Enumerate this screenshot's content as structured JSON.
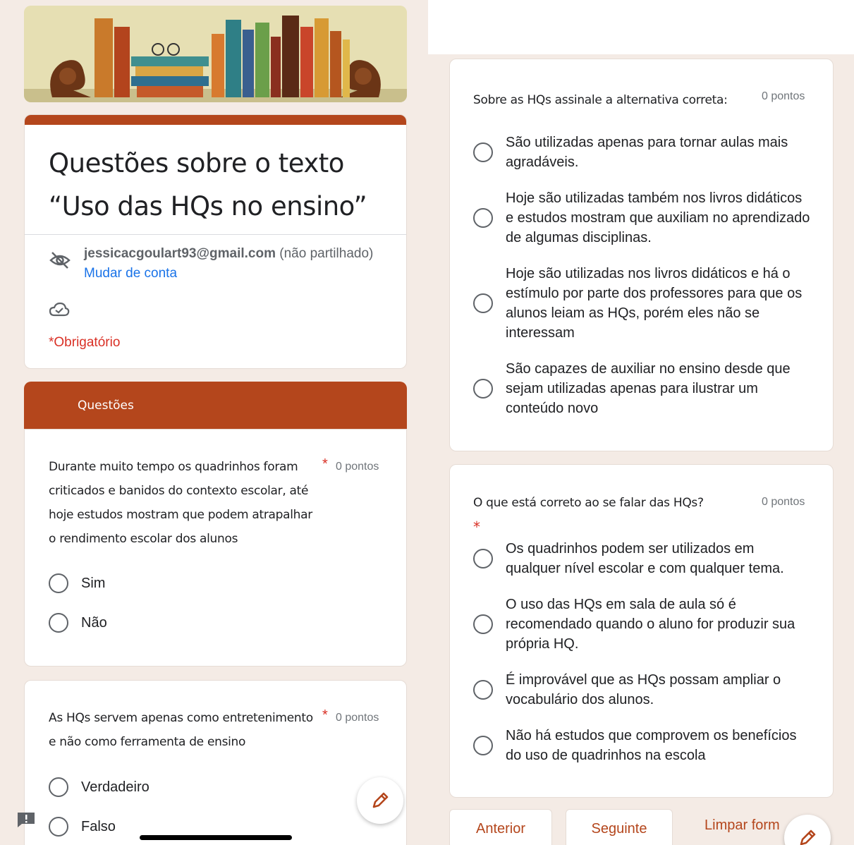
{
  "form": {
    "title": "Questões sobre o texto “Uso das HQs no ensino”",
    "account_email": "jessicacgoulart93@gmail.com",
    "account_note": "(não partilhado)",
    "switch_account": "Mudar de conta",
    "required_note": "*Obrigatório"
  },
  "section": {
    "title": "Questões"
  },
  "left_questions": [
    {
      "text": "Durante muito tempo os quadrinhos foram criticados e banidos do contexto escolar, até hoje estudos mostram que podem atrapalhar o rendimento escolar dos alunos",
      "required_mark": "*",
      "points": "0 pontos",
      "options": [
        "Sim",
        "Não"
      ]
    },
    {
      "text": "As HQs servem apenas como entretenimento e não como ferramenta de ensino",
      "required_mark": "*",
      "points": "0 pontos",
      "options": [
        "Verdadeiro",
        "Falso"
      ]
    }
  ],
  "right_questions": [
    {
      "text": "Sobre as HQs assinale a alternativa correta:",
      "points": "0 pontos",
      "options": [
        "São utilizadas apenas para tornar aulas mais agradáveis.",
        "Hoje são utilizadas também nos livros didáticos e estudos mostram que auxiliam no aprendizado de algumas disciplinas.",
        "Hoje são utilizadas nos livros didáticos e há o estímulo por parte dos professores para que os alunos leiam as HQs, porém eles não se interessam",
        "São capazes de auxiliar no ensino desde que sejam utilizadas apenas para ilustrar um conteúdo novo"
      ]
    },
    {
      "text": "O que está correto ao se falar das HQs?",
      "required_mark": "*",
      "points": "0 pontos",
      "options": [
        "Os quadrinhos podem ser utilizados em qualquer nível escolar e com qualquer tema.",
        "O uso das HQs em sala de aula só é recomendado quando o aluno for produzir sua própria HQ.",
        "É improvável que as HQs possam ampliar o vocabulário dos alunos.",
        "Não há estudos que comprovem os benefícios do uso de quadrinhos na escola"
      ]
    }
  ],
  "nav": {
    "back": "Anterior",
    "next": "Seguinte",
    "clear": "Limpar form"
  },
  "colors": {
    "accent": "#b4461c",
    "background": "#f4ebe5",
    "required": "#d93025",
    "link": "#1a73e8"
  },
  "icons": [
    "visibility-off-icon",
    "cloud-check-icon",
    "edit-pencil-icon",
    "report-problem-icon",
    "radio-button-icon"
  ]
}
